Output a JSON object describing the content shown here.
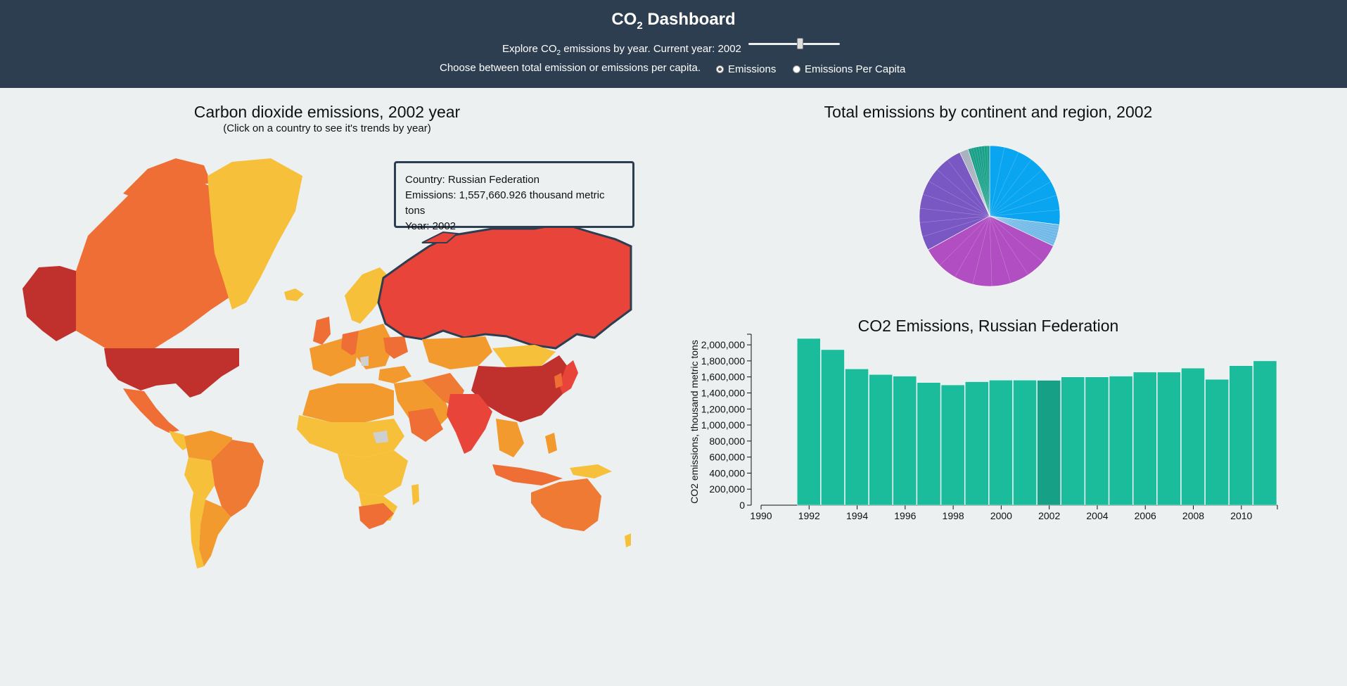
{
  "header": {
    "title_main": "CO",
    "title_sub": "2",
    "title_rest": " Dashboard",
    "slider_label_pre": "Explore CO",
    "slider_label_sub": "2",
    "slider_label_post": " emissions by year. Current year: 2002",
    "slider": {
      "min": 1990,
      "max": 2011,
      "value": 2002
    },
    "radio_prompt": "Choose between total emission or emissions per capita.",
    "radio_options": [
      {
        "label": "Emissions",
        "checked": true
      },
      {
        "label": "Emissions Per Capita",
        "checked": false
      }
    ]
  },
  "map_panel": {
    "title": "Carbon dioxide emissions, 2002 year",
    "subtitle": "(Click on a country to see it's trends by year)",
    "tooltip": {
      "country": "Country: Russian Federation",
      "emissions": "Emissions: 1,557,660.926 thousand metric tons",
      "year": "Year: 2002"
    }
  },
  "pie_panel": {
    "title": "Total emissions by continent and region, 2002"
  },
  "bar_panel": {
    "title": "CO2 Emissions, Russian Federation",
    "ylabel": "CO2 emissions, thousand metric tons"
  },
  "colors": {
    "header_bg": "#2c3e50",
    "page_bg": "#ecf0f1",
    "bar": "#1abc9c",
    "bar_selected": "#16a085",
    "map_low": "#f6c03a",
    "map_mid": "#f09231",
    "map_high": "#e8443a",
    "map_top": "#c0312e",
    "no_data": "#cfcfcf",
    "selected_border": "#2c3e50"
  },
  "chart_data": [
    {
      "type": "pie",
      "title": "Total emissions by continent and region, 2002",
      "slices": [
        {
          "value": 27,
          "color": "#0aa5f0"
        },
        {
          "value": 5,
          "color": "#6fb8e8"
        },
        {
          "value": 35,
          "color": "#b14fc2"
        },
        {
          "value": 26,
          "color": "#7a58c4"
        },
        {
          "value": 2,
          "color": "#a0a8b8"
        },
        {
          "value": 5,
          "color": "#18a088"
        }
      ]
    },
    {
      "type": "bar",
      "title": "CO2 Emissions, Russian Federation",
      "xlabel": "",
      "ylabel": "CO2 emissions, thousand metric tons",
      "x": [
        1992,
        1993,
        1994,
        1995,
        1996,
        1997,
        1998,
        1999,
        2000,
        2001,
        2002,
        2003,
        2004,
        2005,
        2006,
        2007,
        2008,
        2009,
        2010,
        2011
      ],
      "values": [
        2080000,
        1940000,
        1700000,
        1630000,
        1610000,
        1530000,
        1500000,
        1540000,
        1560000,
        1560000,
        1557661,
        1600000,
        1600000,
        1610000,
        1660000,
        1660000,
        1710000,
        1570000,
        1740000,
        1800000
      ],
      "selected": 2002,
      "xlim": [
        1990,
        2011
      ],
      "ylim": [
        0,
        2080000
      ],
      "yticks": [
        0,
        200000,
        400000,
        600000,
        800000,
        1000000,
        1200000,
        1400000,
        1600000,
        1800000,
        2000000
      ],
      "ytick_labels": [
        "0",
        "200,000",
        "400,000",
        "600,000",
        "800,000",
        "1,000,000",
        "1,200,000",
        "1,400,000",
        "1,600,000",
        "1,800,000",
        "2,000,000"
      ],
      "xticks": [
        1990,
        1992,
        1994,
        1996,
        1998,
        2000,
        2002,
        2004,
        2006,
        2008,
        2010
      ],
      "xtick_labels": [
        "1990",
        "1992",
        "1994",
        "1996",
        "1998",
        "2000",
        "2002",
        "2004",
        "2006",
        "2008",
        "2010"
      ]
    }
  ]
}
